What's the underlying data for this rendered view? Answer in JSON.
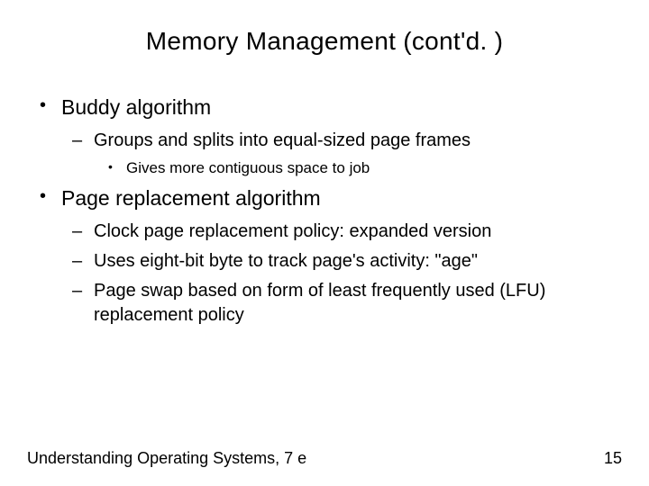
{
  "title": "Memory Management (cont'd. )",
  "bullets": {
    "b1": "Buddy algorithm",
    "b1_1": "Groups and splits into equal-sized page frames",
    "b1_1_1": "Gives more contiguous space to job",
    "b2": "Page replacement algorithm",
    "b2_1": "Clock page replacement policy: expanded version",
    "b2_2": "Uses eight-bit byte to track page's activity: \"age\"",
    "b2_3": "Page swap based on form of least frequently used (LFU) replacement policy"
  },
  "footer": {
    "left": "Understanding Operating Systems, 7 e",
    "right": "15"
  }
}
